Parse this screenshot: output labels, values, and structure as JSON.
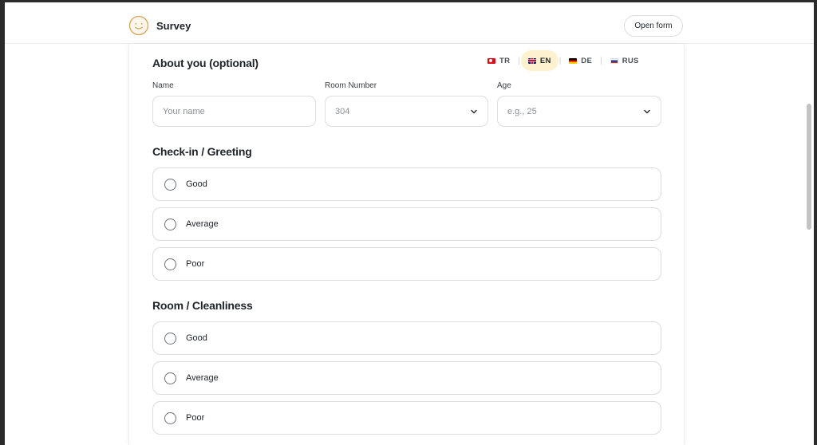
{
  "header": {
    "title": "Survey",
    "open_form_label": "Open form"
  },
  "about": {
    "title": "About you (optional)",
    "languages": [
      {
        "code": "TR",
        "flag": "turkey-flag"
      },
      {
        "code": "EN",
        "flag": "uk-flag",
        "active": true
      },
      {
        "code": "DE",
        "flag": "germany-flag"
      },
      {
        "code": "RUS",
        "flag": "russia-flag"
      }
    ],
    "name": {
      "label": "Name",
      "placeholder": "Your name"
    },
    "room": {
      "label": "Room Number",
      "value": "304"
    },
    "age": {
      "label": "Age",
      "value": "e.g., 25"
    }
  },
  "sections": [
    {
      "title": "Check-in / Greeting",
      "options": [
        "Good",
        "Average",
        "Poor"
      ]
    },
    {
      "title": "Room / Cleanliness",
      "options": [
        "Good",
        "Average",
        "Poor"
      ]
    }
  ],
  "colors": {
    "accent_active_lang": "#fdf1cf",
    "brand_icon": "#d9a35a"
  }
}
